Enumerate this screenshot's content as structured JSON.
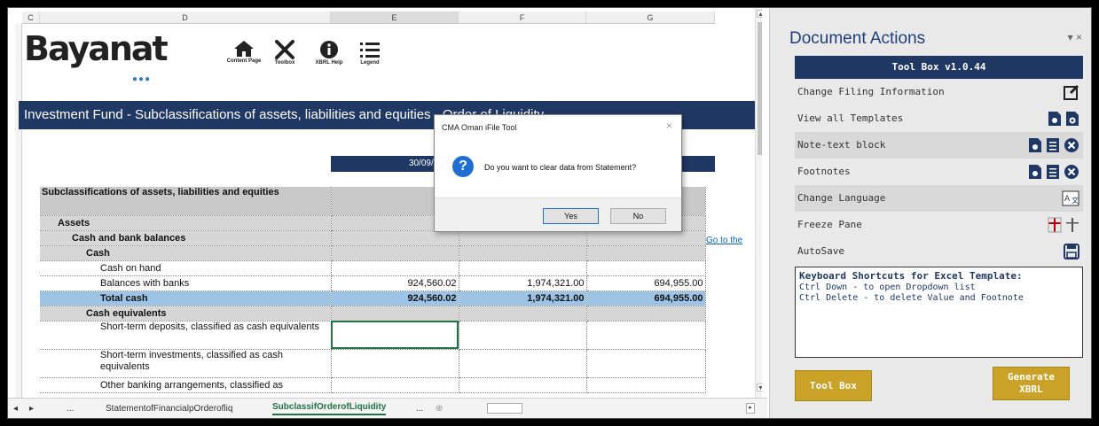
{
  "sheet": {
    "columns": [
      "C",
      "D",
      "E",
      "F",
      "G"
    ],
    "brand": "Bayanat",
    "brand_dots": "●●●",
    "toolbar": [
      {
        "icon": "home-icon",
        "label": "Content Page"
      },
      {
        "icon": "tools-icon",
        "label": "Toolbox"
      },
      {
        "icon": "info-icon",
        "label": "XBRL Help"
      },
      {
        "icon": "list-icon",
        "label": "Legend"
      }
    ],
    "banner": "Investment Fund -  Subclassifications of assets, liabilities and equities - Order of Liquidity",
    "date": "30/09/2021",
    "goto_link": "Go to the",
    "rows": [
      {
        "label": "Subclassifications of assets, liabilities and equities",
        "e": "",
        "f": "",
        "g": ""
      },
      {
        "label": "Assets",
        "e": "",
        "f": "",
        "g": ""
      },
      {
        "label": "Cash and bank balances",
        "e": "",
        "f": "",
        "g": ""
      },
      {
        "label": "Cash",
        "e": "",
        "f": "",
        "g": ""
      },
      {
        "label": "Cash on hand",
        "e": "",
        "f": "",
        "g": ""
      },
      {
        "label": "Balances with banks",
        "e": "924,560.02",
        "f": "1,974,321.00",
        "g": "694,955.00"
      },
      {
        "label": "Total cash",
        "e": "924,560.02",
        "f": "1,974,321.00",
        "g": "694,955.00"
      },
      {
        "label": "Cash equivalents",
        "e": "",
        "f": "",
        "g": ""
      },
      {
        "label": "Short-term deposits, classified as cash equivalents",
        "e": "",
        "f": "",
        "g": ""
      },
      {
        "label": "Short-term investments, classified as cash equivalents",
        "e": "",
        "f": "",
        "g": ""
      },
      {
        "label": "Other banking arrangements, classified as",
        "e": "",
        "f": "",
        "g": ""
      }
    ],
    "tabs": {
      "more_left": "...",
      "tab1": "StatementofFinancialpOrderofliq",
      "tab2": "SubclassifOrderofLiquidity",
      "more_right": "...",
      "add": "⊕"
    }
  },
  "dialog": {
    "title": "CMA Oman iFile Tool",
    "close": "×",
    "icon": "question-icon",
    "message": "Do you want to clear data from Statement?",
    "yes": "Yes",
    "no": "No"
  },
  "pane": {
    "title": "Document Actions",
    "controls": "▾ ×",
    "toolbox_header": "Tool Box v1.0.44",
    "actions": [
      {
        "label": "Change Filing Information",
        "icons": [
          "edit-icon"
        ]
      },
      {
        "label": "View all Templates",
        "icons": [
          "doc-view-icon",
          "doc-gear-icon"
        ]
      },
      {
        "label": "Note-text block",
        "icons": [
          "doc-view-icon",
          "note-icon",
          "remove-icon"
        ]
      },
      {
        "label": "Footnotes",
        "icons": [
          "doc-view-icon",
          "note-icon",
          "remove-icon"
        ]
      },
      {
        "label": "Change Language",
        "icons": [
          "translate-icon"
        ]
      },
      {
        "label": "Freeze Pane",
        "icons": [
          "freeze-red-icon",
          "freeze-gray-icon"
        ]
      },
      {
        "label": "AutoSave",
        "icons": [
          "save-icon"
        ]
      }
    ],
    "shortcuts": {
      "title": "Keyboard Shortcuts for Excel Template:",
      "lines": [
        "Ctrl Down - to open Dropdown list",
        "Ctrl Delete - to delete Value and Footnote"
      ]
    },
    "toolbox_button": "Tool Box",
    "generate_button": "Generate XBRL"
  },
  "colors": {
    "navy": "#1f3864",
    "gold": "#c9a227",
    "total_row": "#9dc3e6",
    "excel_green": "#217346"
  }
}
